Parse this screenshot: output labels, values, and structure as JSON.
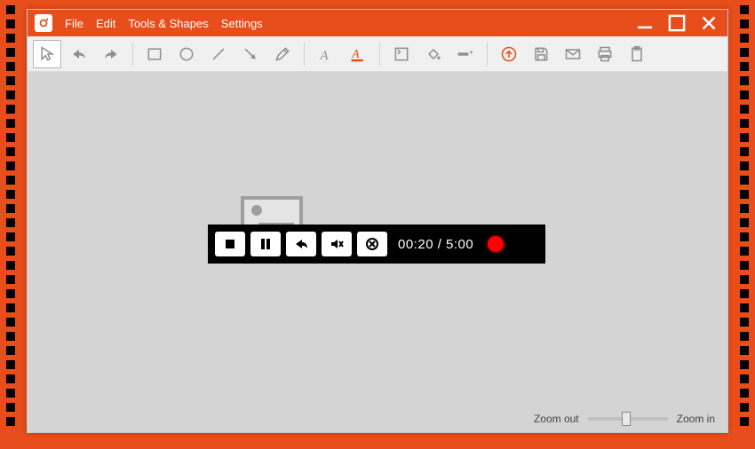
{
  "menu": {
    "file": "File",
    "edit": "Edit",
    "tools": "Tools & Shapes",
    "settings": "Settings"
  },
  "player": {
    "time": "00:20 / 5:00"
  },
  "zoom": {
    "out": "Zoom out",
    "in": "Zoom in"
  }
}
